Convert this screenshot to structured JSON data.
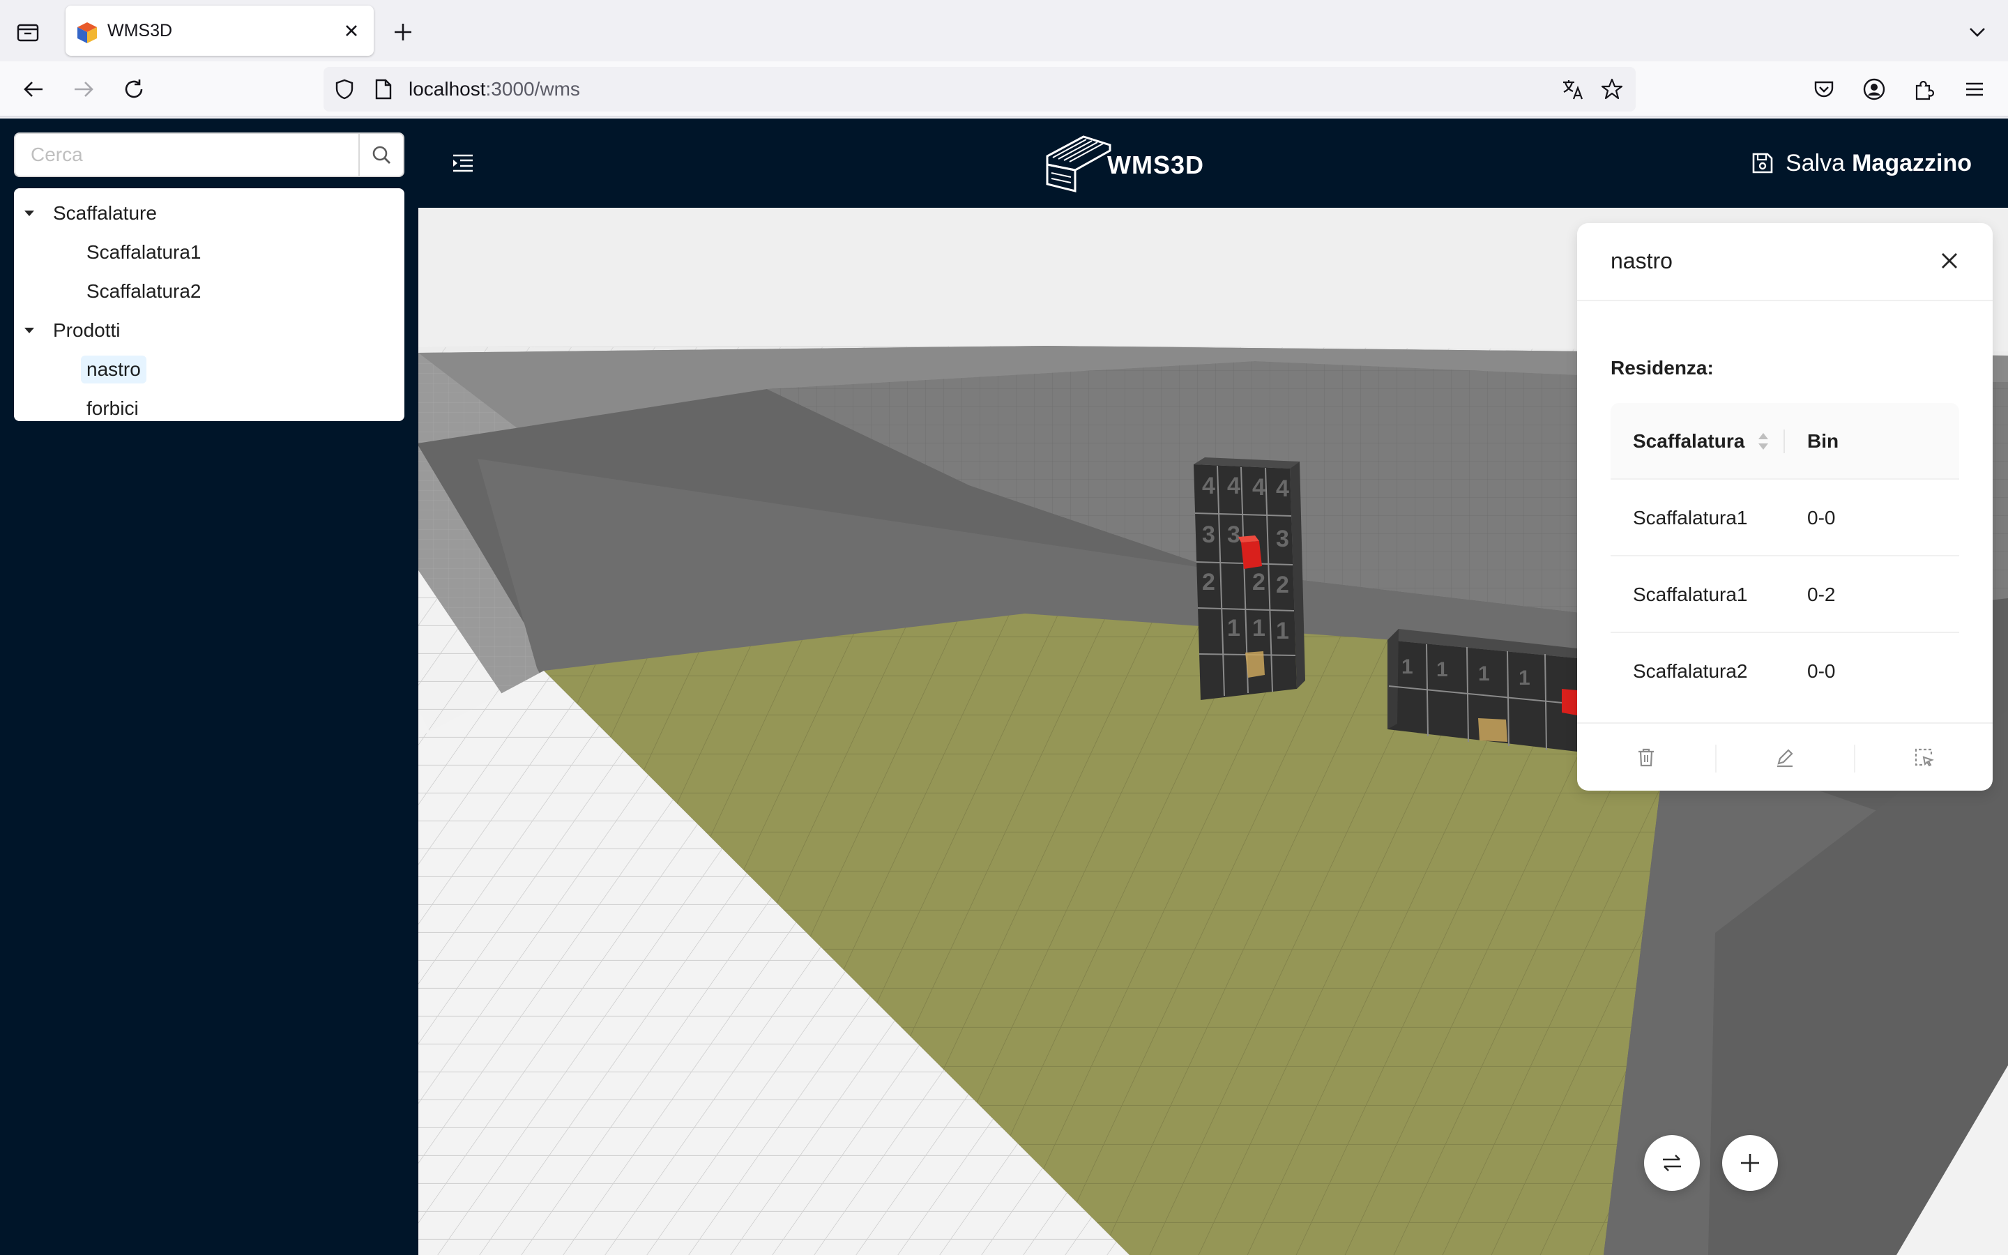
{
  "browser": {
    "tab_title": "WMS3D",
    "url_host": "localhost",
    "url_rest": ":3000/wms"
  },
  "sidebar": {
    "search_placeholder": "Cerca",
    "tree": {
      "groups": [
        {
          "label": "Scaffalature",
          "children": [
            "Scaffalatura1",
            "Scaffalatura2"
          ]
        },
        {
          "label": "Prodotti",
          "children": [
            "nastro",
            "forbici"
          ],
          "selected": "nastro"
        }
      ]
    }
  },
  "header": {
    "logo_text": "WMS3D",
    "save_label": "Salva",
    "save_label_bold": "Magazzino"
  },
  "panel": {
    "title": "nastro",
    "residence_label": "Residenza:",
    "columns": [
      "Scaffalatura",
      "Bin"
    ],
    "rows": [
      [
        "Scaffalatura1",
        "0-0"
      ],
      [
        "Scaffalatura1",
        "0-2"
      ],
      [
        "Scaffalatura2",
        "0-0"
      ]
    ]
  },
  "icons": {
    "tab_overview": "tab-overview-icon",
    "favicon": "cube-favicon-icon",
    "tab_close": "close-icon",
    "new_tab": "plus-icon",
    "tab_list": "chevron-down-icon",
    "back": "arrow-left-icon",
    "forward": "arrow-right-icon",
    "reload": "reload-icon",
    "shield": "shield-icon",
    "page": "page-icon",
    "translate": "translate-icon",
    "bookmark": "star-icon",
    "pocket": "pocket-icon",
    "account": "account-icon",
    "extensions": "puzzle-icon",
    "menu": "hamburger-icon",
    "search": "search-icon",
    "menu_fold": "menu-fold-icon",
    "save": "save-icon",
    "delete": "delete-icon",
    "edit": "edit-icon",
    "select": "select-icon",
    "swap": "swap-icon",
    "add": "plus-icon"
  },
  "colors": {
    "dark_nav": "#001529",
    "floor_zone": "#959656",
    "selected_bg": "#e6f4ff",
    "cube_red": "#d9201c",
    "cube_yellow": "#c9a55c"
  }
}
